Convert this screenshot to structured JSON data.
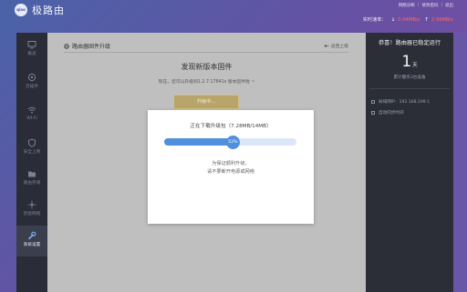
{
  "header": {
    "logo_badge": "qiao",
    "brand": "极路由",
    "links": [
      "网络诊断",
      "修改密码",
      "退出"
    ],
    "speed_label": "实时速率：",
    "speed_down": "0.04MB/s",
    "speed_up": "2.99MB/s"
  },
  "sidebar": {
    "items": [
      {
        "label": "概览",
        "icon": "monitor-icon"
      },
      {
        "label": "云插件",
        "icon": "cloud-plugin-icon"
      },
      {
        "label": "WI-FI",
        "icon": "wifi-icon"
      },
      {
        "label": "安全上网",
        "icon": "security-icon"
      },
      {
        "label": "路由存储",
        "icon": "storage-icon"
      },
      {
        "label": "智能网络",
        "icon": "smart-network-icon"
      },
      {
        "label": "系统设置",
        "icon": "wrench-icon"
      }
    ]
  },
  "main": {
    "title": "路由器固件升级",
    "back": "返回上级",
    "found_title": "发现新版本固件",
    "found_desc": "现在，您可以升级到1.2.7.17841s 版本固件啦 ~",
    "upgrade_button": "升级中..."
  },
  "modal": {
    "title": "正在下载升级包（7.28MB/14MB）",
    "progress_percent": 52,
    "progress_label": "52%",
    "note1": "为保证顺利升级，",
    "note2": "请不要断开电源或网络"
  },
  "status_panel": {
    "congrats": "恭喜！路由器已稳定运行",
    "days": "1",
    "days_unit": "天",
    "served": "累计服务3台设备",
    "ip": "局域网IP：192.168.199.1",
    "sync": "自动同步时间"
  },
  "colors": {
    "progress": "#4f8fde",
    "speed_value": "#ff6b6b",
    "upgrade_btn": "#b8a56a"
  }
}
